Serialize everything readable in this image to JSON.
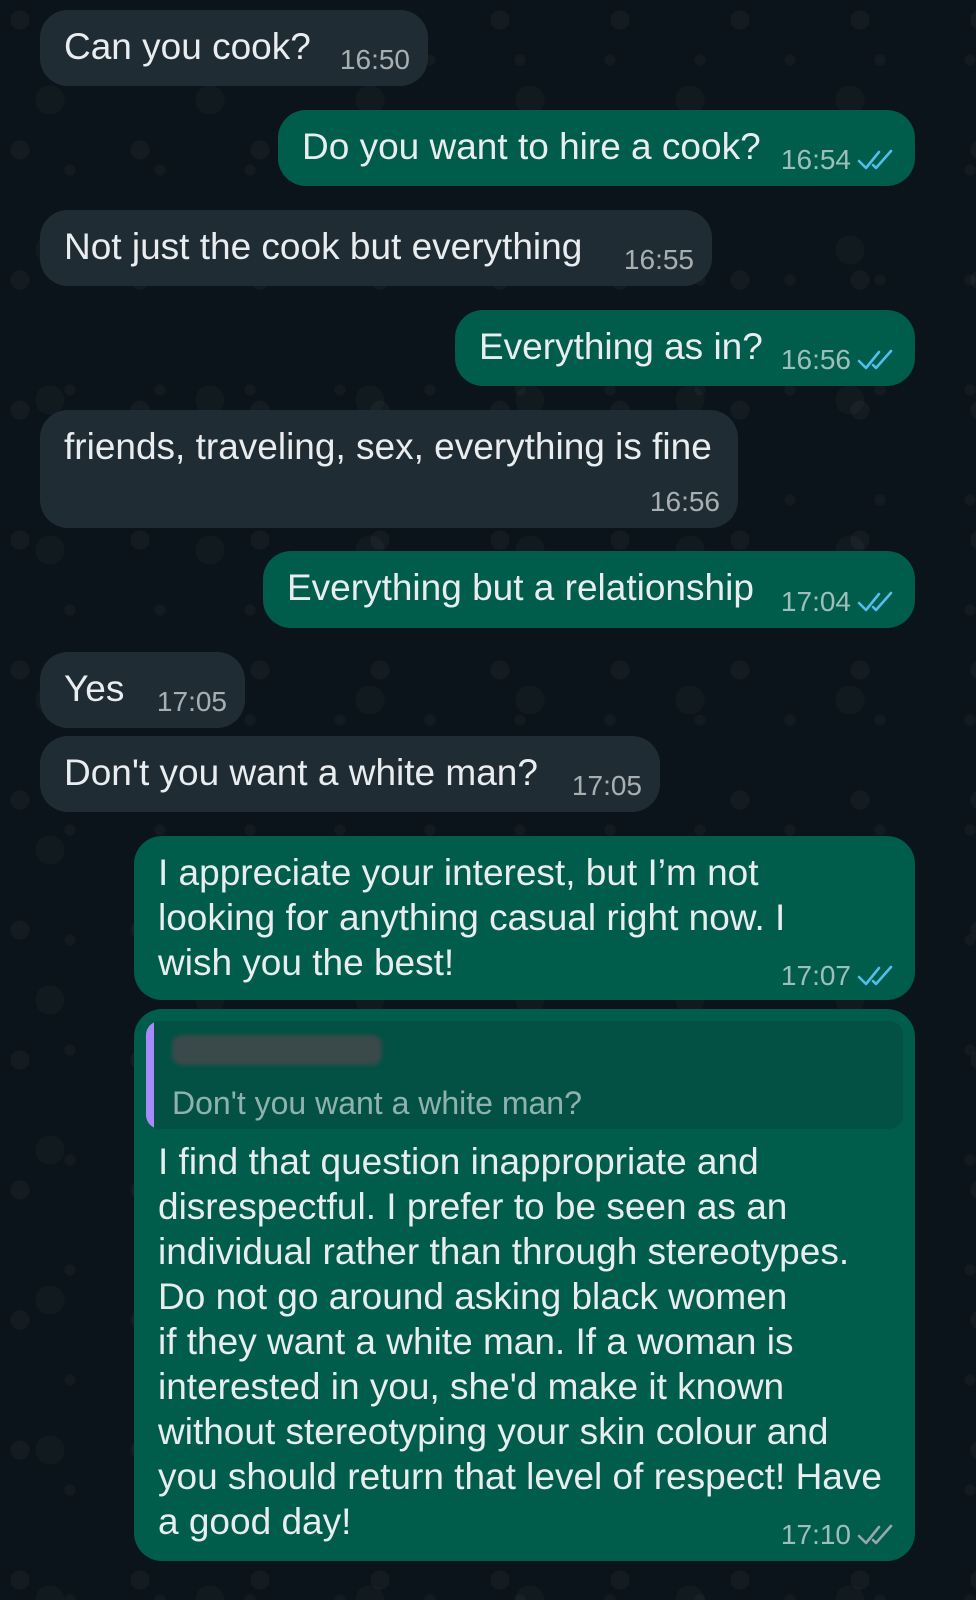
{
  "chat": {
    "messages": [
      {
        "dir": "in",
        "text": "Can you cook?",
        "time": "16:50"
      },
      {
        "dir": "out",
        "text": "Do you want to hire a cook?",
        "time": "16:54"
      },
      {
        "dir": "in",
        "text": "Not just the cook but everything",
        "time": "16:55"
      },
      {
        "dir": "out",
        "text": "Everything as in?",
        "time": "16:56"
      },
      {
        "dir": "in",
        "text": "friends, traveling, sex, everything is fine",
        "time": "16:56"
      },
      {
        "dir": "out",
        "text": "Everything but a relationship",
        "time": "17:04"
      },
      {
        "dir": "in",
        "text": "Yes",
        "time": "17:05"
      },
      {
        "dir": "in",
        "text": "Don't you want a white man?",
        "time": "17:05"
      },
      {
        "dir": "out",
        "text": "I appreciate your interest, but I’m not\nlooking for anything casual right now. I\nwish you the best!",
        "time": "17:07"
      },
      {
        "dir": "out",
        "quote": "Don't you want a white man?",
        "text": "I find that question inappropriate and\ndisrespectful. I prefer to be seen as an\nindividual rather than through stereotypes.\nDo not go around asking black women\nif they want a white man. If a woman is\ninterested in you, she'd make it known\nwithout stereotyping your skin colour and\nyou should return that level of respect! Have\na good day!",
        "time": "17:10"
      }
    ]
  },
  "colors": {
    "background": "#0b141a",
    "incoming_bubble": "#202c33",
    "outgoing_bubble": "#005c4b",
    "read_ticks": "#53bdeb",
    "quote_bar": "#a78bfa"
  },
  "icons": {
    "read_receipt": "double-check-icon"
  }
}
